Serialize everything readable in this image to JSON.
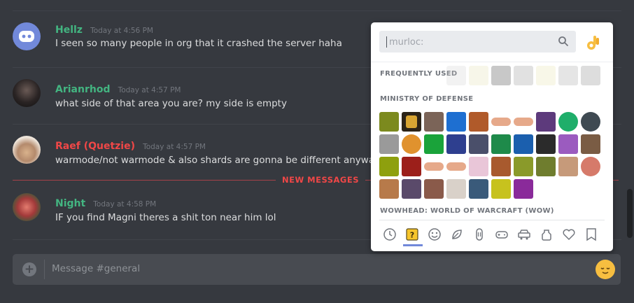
{
  "messages": [
    {
      "author": "Hellz",
      "timestamp": "Today at 4:56 PM",
      "text": "I seen so many people in org that it crashed the server haha",
      "color": "#43b581"
    },
    {
      "author": "Arianrhod",
      "timestamp": "Today at 4:57 PM",
      "text": "what side of that area you are? my side is empty",
      "color": "#43b581"
    },
    {
      "author": "Raef (Quetzie)",
      "timestamp": "Today at 4:57 PM",
      "text": "warmode/not warmode & also shards are gonna be different anyway",
      "color": "#f04747"
    },
    {
      "author": "Night",
      "timestamp": "Today at 4:58 PM",
      "text": "IF you find Magni theres a shit ton near him lol",
      "color": "#43b581"
    }
  ],
  "new_messages_label": "NEW MESSAGES",
  "composer": {
    "placeholder": "Message #general"
  },
  "emoji_picker": {
    "search_placeholder": "murloc:",
    "categories": [
      "FREQUENTLY USED",
      "MINISTRY OF DEFENSE",
      "WOWHEAD: WORLD OF WARCRAFT (WOW)"
    ],
    "tabs": [
      "recent-icon",
      "custom-server-icon",
      "people-icon",
      "nature-icon",
      "food-icon",
      "activity-icon",
      "travel-icon",
      "objects-icon",
      "symbols-icon",
      "flags-icon"
    ]
  },
  "colors": {
    "background": "#36393f",
    "accent": "#7289da",
    "new_messages": "#f04747",
    "username_green": "#43b581",
    "username_red": "#f04747"
  }
}
